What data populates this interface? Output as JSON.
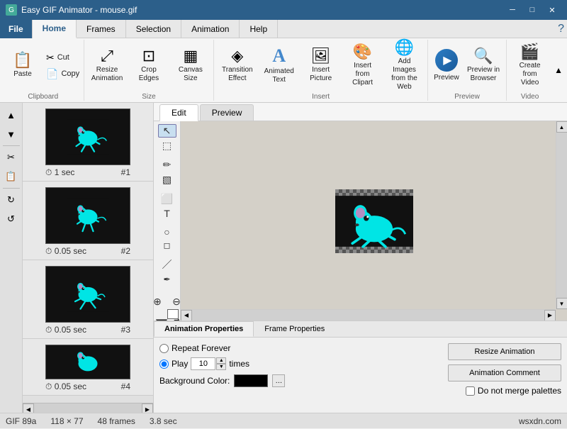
{
  "titleBar": {
    "title": "Easy GIF Animator - mouse.gif",
    "minBtn": "─",
    "maxBtn": "□",
    "closeBtn": "✕"
  },
  "ribbon": {
    "tabs": [
      "File",
      "Home",
      "Frames",
      "Selection",
      "Animation",
      "Help"
    ],
    "activeTab": "Home",
    "groups": {
      "clipboard": {
        "label": "Clipboard",
        "buttons": [
          {
            "id": "paste",
            "label": "Paste",
            "icon": "📋"
          },
          {
            "id": "cut",
            "label": "Cut",
            "icon": "✂️"
          },
          {
            "id": "copy",
            "label": "Copy",
            "icon": "📄"
          }
        ]
      },
      "size": {
        "label": "Size",
        "buttons": [
          {
            "id": "resize",
            "label": "Resize Animation",
            "icon": "⤢"
          },
          {
            "id": "crop",
            "label": "Crop Edges",
            "icon": "⊡"
          },
          {
            "id": "canvas",
            "label": "Canvas Size",
            "icon": "▦"
          }
        ]
      },
      "insert": {
        "label": "Insert",
        "buttons": [
          {
            "id": "transition",
            "label": "Transition Effect",
            "icon": "◈"
          },
          {
            "id": "animtext",
            "label": "Animated Text",
            "icon": "A"
          },
          {
            "id": "insertpic",
            "label": "Insert Picture",
            "icon": "🖼"
          },
          {
            "id": "fromweb",
            "label": "Insert from Clipart",
            "icon": "🎨"
          },
          {
            "id": "addimages",
            "label": "Add Images from the Web",
            "icon": "🌐"
          }
        ]
      },
      "preview": {
        "label": "Preview",
        "buttons": [
          {
            "id": "preview",
            "label": "Preview",
            "icon": "▶"
          },
          {
            "id": "previewbrowser",
            "label": "Preview in Browser",
            "icon": "🔍"
          }
        ]
      },
      "video": {
        "label": "Video",
        "buttons": [
          {
            "id": "createvideo",
            "label": "Create from Video",
            "icon": "🎬"
          }
        ]
      }
    }
  },
  "editPreviewTabs": [
    "Edit",
    "Preview"
  ],
  "activeEditTab": "Edit",
  "tools": {
    "list": [
      "↖",
      "⬚",
      "✏",
      "⬜",
      "○",
      "／",
      "🔤",
      "🪄",
      "⬛",
      "↔",
      "⊕",
      "⊖",
      "▣"
    ]
  },
  "frames": [
    {
      "duration": "1 sec",
      "number": "#1"
    },
    {
      "duration": "0.05 sec",
      "number": "#2"
    },
    {
      "duration": "0.05 sec",
      "number": "#3"
    },
    {
      "duration": "0.05 sec",
      "number": "#4"
    }
  ],
  "properties": {
    "tabs": [
      "Animation Properties",
      "Frame Properties"
    ],
    "activeTab": "Animation Properties",
    "repeatForever": "Repeat Forever",
    "playLabel": "Play",
    "playTimes": "10",
    "timesLabel": "times",
    "bgColorLabel": "Background Color:",
    "resizeBtn": "Resize Animation",
    "commentBtn": "Animation Comment",
    "mergeLabel": "Do not merge palettes"
  },
  "statusBar": {
    "format": "GIF 89a",
    "dimensions": "118 × 77",
    "frames": "48 frames",
    "duration": "3.8 sec",
    "website": "wsxdn.com"
  },
  "leftSidebarTools": [
    "↑",
    "↓",
    "✂",
    "📋",
    "🔄",
    "🔁"
  ]
}
